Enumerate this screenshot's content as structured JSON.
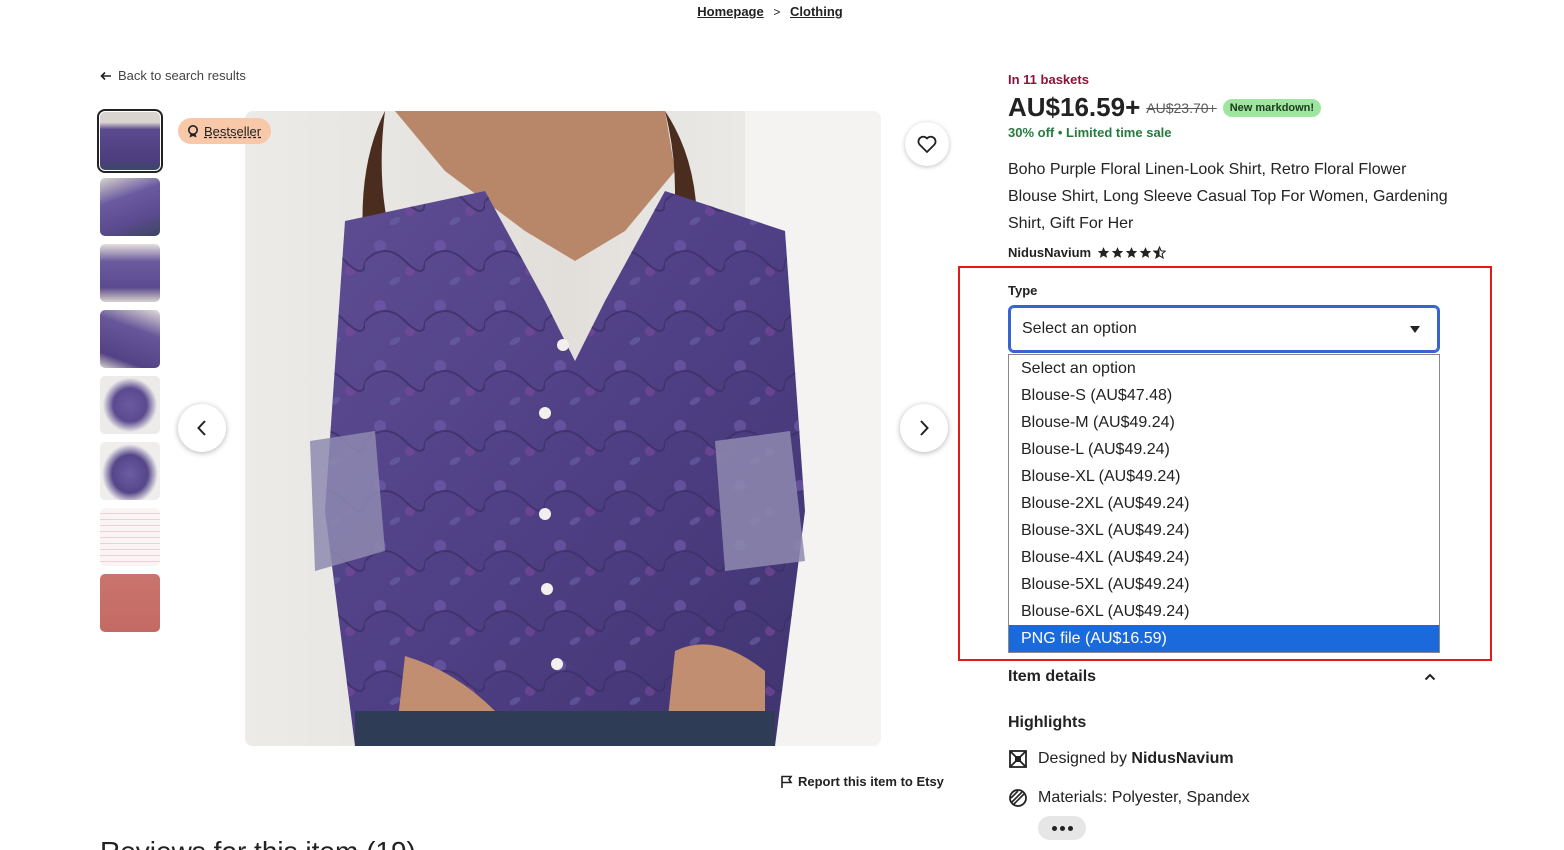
{
  "breadcrumb": {
    "items": [
      "Homepage",
      "Clothing"
    ],
    "separator": ">"
  },
  "back_link": "Back to search results",
  "badge": {
    "label": "Bestseller"
  },
  "report_link": "Report this item to Etsy",
  "reviews_heading": "Reviews for this item (19)",
  "product": {
    "in_baskets": "In 11 baskets",
    "price": "AU$16.59+",
    "price_old": "AU$23.70+",
    "markdown_badge": "New markdown!",
    "discount": "30% off",
    "sale_text": "Limited time sale",
    "title": "Boho Purple Floral Linen-Look Shirt, Retro Floral Flower Blouse Shirt, Long Sleeve Casual Top For Women, Gardening Shirt, Gift For Her",
    "shop_name": "NidusNavium",
    "rating_stars": 4.5
  },
  "type_select": {
    "label": "Type",
    "current_value": "Select an option",
    "options": [
      "Select an option",
      "Blouse-S (AU$47.48)",
      "Blouse-M (AU$49.24)",
      "Blouse-L (AU$49.24)",
      "Blouse-XL (AU$49.24)",
      "Blouse-2XL (AU$49.24)",
      "Blouse-3XL (AU$49.24)",
      "Blouse-4XL (AU$49.24)",
      "Blouse-5XL (AU$49.24)",
      "Blouse-6XL (AU$49.24)",
      "PNG file (AU$16.59)"
    ],
    "highlighted_option": "PNG file (AU$16.59)"
  },
  "item_details": {
    "label": "Item details"
  },
  "highlights": {
    "heading": "Highlights",
    "designed_prefix": "Designed by",
    "designed_by": "NidusNavium",
    "materials": "Materials: Polyester, Spandex"
  },
  "colors": {
    "price_discount": "#257b3f",
    "baskets": "#8a1538",
    "badge_bg": "#f8c8a8",
    "markdown_bg": "#9ee5a0",
    "select_focus": "#3764d0",
    "option_highlight": "#1a6adb",
    "annotation_box": "#e21a1a",
    "shirt_purple": "#5b4a8f"
  }
}
